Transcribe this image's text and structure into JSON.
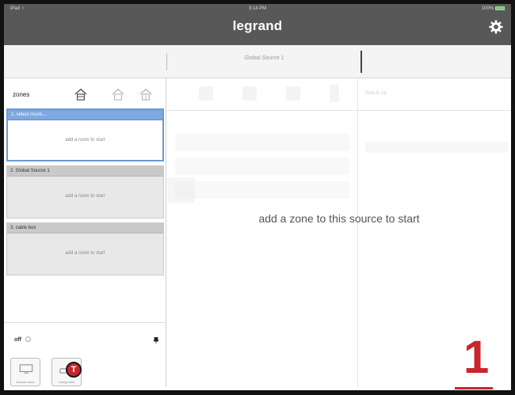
{
  "status_bar": {
    "carrier": "iPad ♀",
    "time": "3:14 PM",
    "battery": "100%"
  },
  "header": {
    "title": "legrand",
    "settings_icon": "gear-icon"
  },
  "source_bar": {
    "current_source": "Global Source 1"
  },
  "zones_panel": {
    "title": "zones",
    "filter_icons": [
      "home-icon",
      "home-icon",
      "home-icon"
    ],
    "zones": [
      {
        "name": "1. select music...",
        "prompt": "add a room to start",
        "selected": true
      },
      {
        "name": "2. Global Source 1",
        "prompt": "add a room to start",
        "selected": false
      },
      {
        "name": "3. cable box",
        "prompt": "add a room to start",
        "selected": false
      }
    ],
    "power_label": "off",
    "devices": [
      {
        "label": "Source room"
      },
      {
        "label": "Living room"
      }
    ],
    "badge_label": "T"
  },
  "main": {
    "empty_message": "add a zone to this source to start",
    "ghost_tab": "Now & Up"
  },
  "annotation": {
    "step": "1"
  },
  "colors": {
    "header_bg": "#585858",
    "accent_blue": "#7ea8e0",
    "annotation_red": "#c9252c"
  }
}
